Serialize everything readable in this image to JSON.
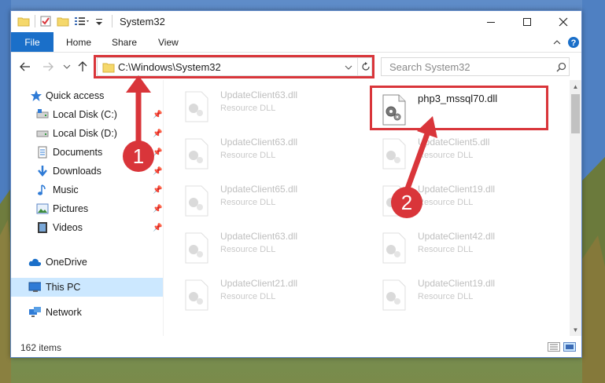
{
  "window": {
    "title": "System32",
    "controls": [
      "minimize",
      "maximize",
      "close"
    ]
  },
  "ribbon": {
    "tabs": [
      {
        "label": "File",
        "active": true
      },
      {
        "label": "Home"
      },
      {
        "label": "Share"
      },
      {
        "label": "View"
      }
    ]
  },
  "address": {
    "path": "C:\\Windows\\System32",
    "search_placeholder": "Search System32"
  },
  "sidebar": {
    "items": [
      {
        "label": "Quick access",
        "icon": "star-icon",
        "pinned": false
      },
      {
        "label": "Local Disk (C:)",
        "icon": "drive-icon",
        "pinned": true
      },
      {
        "label": "Local Disk (D:)",
        "icon": "drive-icon",
        "pinned": true
      },
      {
        "label": "Documents",
        "icon": "documents-icon",
        "pinned": true
      },
      {
        "label": "Downloads",
        "icon": "downloads-icon",
        "pinned": true
      },
      {
        "label": "Music",
        "icon": "music-icon",
        "pinned": true
      },
      {
        "label": "Pictures",
        "icon": "pictures-icon",
        "pinned": true
      },
      {
        "label": "Videos",
        "icon": "videos-icon",
        "pinned": true
      },
      {
        "label": "OneDrive",
        "icon": "cloud-icon",
        "pinned": false
      },
      {
        "label": "This PC",
        "icon": "computer-icon",
        "pinned": false,
        "selected": true
      },
      {
        "label": "Network",
        "icon": "network-icon",
        "pinned": false
      }
    ]
  },
  "files": {
    "highlighted": {
      "name": "php3_mssql70.dll"
    },
    "left_column": [
      {
        "name": "UpdateClient63.dll",
        "type": "Resource DLL"
      },
      {
        "name": "UpdateClient63.dll",
        "type": "Resource DLL"
      },
      {
        "name": "UpdateClient65.dll",
        "type": "Resource DLL"
      },
      {
        "name": "UpdateClient63.dll",
        "type": "Resource DLL"
      },
      {
        "name": "UpdateClient21.dll",
        "type": "Resource DLL"
      }
    ],
    "right_column": [
      {
        "name": "UpdateClient5.dll",
        "type": "Resource DLL"
      },
      {
        "name": "UpdateClient19.dll",
        "type": "Resource DLL"
      },
      {
        "name": "UpdateClient42.dll",
        "type": "Resource DLL"
      },
      {
        "name": "UpdateClient19.dll",
        "type": "Resource DLL"
      }
    ]
  },
  "status": {
    "item_count": "162 items"
  },
  "annotations": {
    "marker1": "1",
    "marker2": "2",
    "color": "#d9353a"
  }
}
